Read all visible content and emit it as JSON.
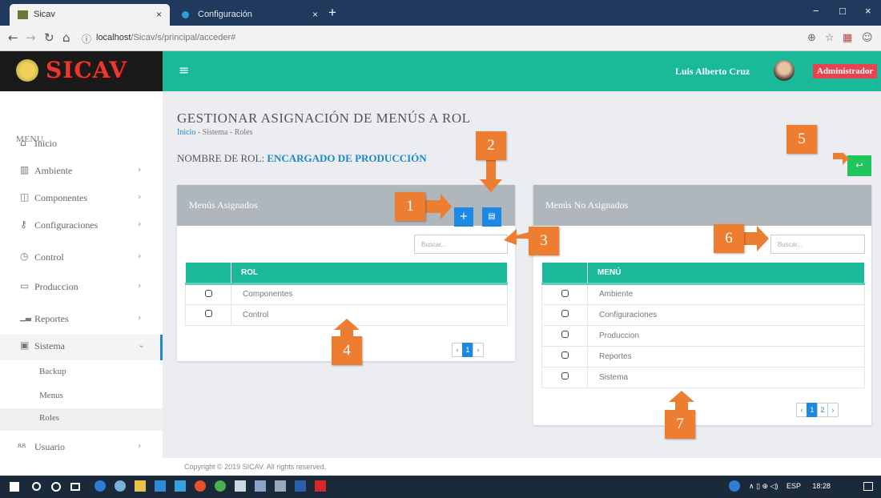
{
  "browser": {
    "tabs": [
      {
        "label": "Sicav",
        "close": "×"
      },
      {
        "label": "Configuración",
        "close": "×"
      }
    ],
    "new_tab": "+",
    "window_controls": [
      "−",
      "□",
      "×"
    ],
    "url_host": "localhost",
    "url_path": "/Sicav/s/principal/acceder#"
  },
  "header": {
    "brand": "SICAV",
    "menu_toggle": "≡",
    "user_name": "Luis Alberto Cruz",
    "role_badge": "Administrador"
  },
  "sidebar": {
    "title": "MENU",
    "items": [
      {
        "label": "Inicio",
        "icon": "home-icon",
        "glyph": "⌂",
        "chevron": ""
      },
      {
        "label": "Ambiente",
        "icon": "building-icon",
        "glyph": "▥",
        "chevron": "›"
      },
      {
        "label": "Componentes",
        "icon": "cube-icon",
        "glyph": "◫",
        "chevron": "›"
      },
      {
        "label": "Configuraciones",
        "icon": "key-icon",
        "glyph": "⚷",
        "chevron": "›"
      },
      {
        "label": "Control",
        "icon": "dashboard-icon",
        "glyph": "◷",
        "chevron": "›"
      },
      {
        "label": "Produccion",
        "icon": "folder-icon",
        "glyph": "▭",
        "chevron": "›"
      },
      {
        "label": "Reportes",
        "icon": "bar-chart-icon",
        "glyph": "▁▃",
        "chevron": "›"
      },
      {
        "label": "Sistema",
        "icon": "monitor-icon",
        "glyph": "▣",
        "chevron": "⌄"
      },
      {
        "label": "Usuario",
        "icon": "users-icon",
        "glyph": "ጸጸ",
        "chevron": "›"
      }
    ],
    "sub_items": [
      "Backup",
      "Menus",
      "Roles"
    ]
  },
  "page": {
    "title": "GESTIONAR ASIGNACIÓN DE MENÚS A ROL",
    "breadcrumb": [
      "Inicio",
      "Sistema",
      "Roles"
    ],
    "role_label": "NOMBRE DE ROL:",
    "role_value": "ENCARGADO DE PRODUCCIÓN",
    "back_glyph": "↩"
  },
  "assigned": {
    "title": "Menús Asignados",
    "add_glyph": "+",
    "delete_glyph": "🗑",
    "search_placeholder": "Buscar...",
    "header": "ROL",
    "rows": [
      "Componentes",
      "Control"
    ],
    "pager": [
      "‹",
      "1",
      "›"
    ]
  },
  "unassigned": {
    "title": "Menús No Asignados",
    "search_placeholder": "Buscar...",
    "header": "MENÚ",
    "rows": [
      "Ambiente",
      "Configuraciones",
      "Produccion",
      "Reportes",
      "Sistema"
    ],
    "pager": [
      "‹",
      "1",
      "2",
      "›"
    ]
  },
  "callouts": [
    "1",
    "2",
    "3",
    "4",
    "5",
    "6",
    "7"
  ],
  "footer": "Copyright © 2019 SICAV. All rights reserved.",
  "taskbar": {
    "lang": "ESP",
    "time": "18:28"
  },
  "colors": {
    "teal": "#19b99a",
    "blue": "#1e88e5",
    "green": "#20c65b",
    "orange": "#ed7d31",
    "badge": "#e8434f",
    "panel_head": "#afb7bd"
  }
}
